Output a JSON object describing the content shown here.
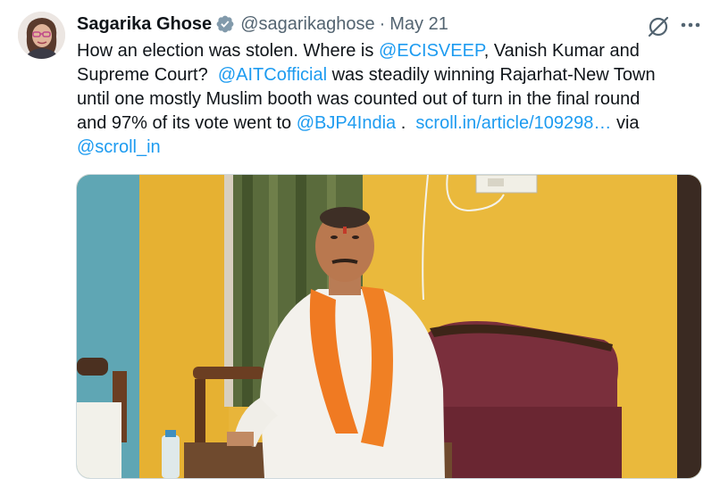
{
  "tweet": {
    "author_name": "Sagarika Ghose",
    "handle": "@sagarikaghose",
    "separator": "·",
    "date": "May 21",
    "verified_icon": "verified-badge-icon",
    "text": {
      "l1_a": "How an election was stolen. Where is ",
      "l1_link": "@ECISVEEP",
      "l1_b": ", Vanish Kumar and",
      "l2_a": "Supreme Court?  ",
      "l2_link": "@AITCofficial",
      "l2_b": " was steadily winning Rajarhat-New Town",
      "l3": "until one mostly Muslim booth was counted out of turn in the final round",
      "l4_a": "and 97% of its vote went to ",
      "l4_link": "@BJP4India",
      "l4_b": " .  ",
      "l4_url": "scroll.in/article/109298…",
      "l4_c": " via",
      "l5_link": "@scroll_in"
    },
    "actions": {
      "grok_icon": "grok-icon",
      "more_icon": "more-horizontal-icon"
    },
    "media_alt": "Man in white kurta with orange scarf seated on a chair"
  },
  "colors": {
    "link": "#1d9bf0",
    "secondary_text": "#536471",
    "verified": "#829aab"
  }
}
